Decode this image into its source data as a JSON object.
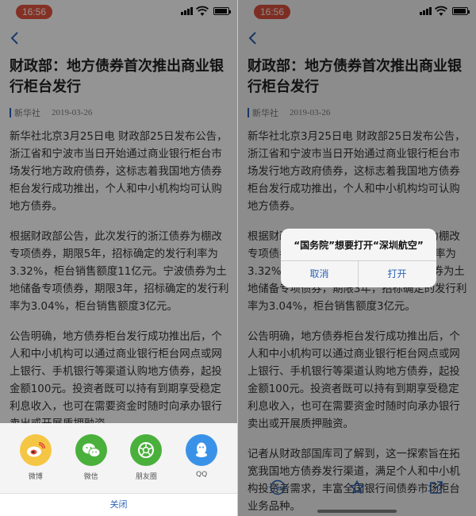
{
  "status": {
    "time": "16:56"
  },
  "article": {
    "title": "财政部：地方债券首次推出商业银行柜台发行",
    "source": "新华社",
    "date": "2019-03-26",
    "paragraphs": [
      "新华社北京3月25日电 财政部25日发布公告，浙江省和宁波市当日开始通过商业银行柜台市场发行地方政府债券，这标志着我国地方债券柜台发行成功推出，个人和中小机构均可认购地方债券。",
      "根据财政部公告，此次发行的浙江债券为棚改专项债券，期限5年，招标确定的发行利率为3.32%，柜台销售额度11亿元。宁波债券为土地储备专项债券，期限3年，招标确定的发行利率为3.04%，柜台销售额度3亿元。",
      "公告明确，地方债券柜台发行成功推出后，个人和中小机构可以通过商业银行柜台网点或网上银行、手机银行等渠道认购地方债券，起投金额100元。投资者既可以持有到期享受稳定利息收入，也可在需要资金时随时向承办银行卖出或开展质押融资。",
      "记者从财政部国库司了解到，这一探索旨在拓宽我国地方债券发行渠道，满足个人和中小机构投资者需求，丰富全国银行间债券市场柜台业务品种。"
    ]
  },
  "share_sheet": {
    "items": [
      {
        "label": "微博",
        "icon": "weibo-icon",
        "color": "#f5c644"
      },
      {
        "label": "微信",
        "icon": "wechat-icon",
        "color": "#4ab03c"
      },
      {
        "label": "朋友圈",
        "icon": "moments-icon",
        "color": "#4ab03c"
      },
      {
        "label": "QQ",
        "icon": "qq-icon",
        "color": "#3a92e8"
      }
    ],
    "close_label": "关闭"
  },
  "dialog": {
    "title": "“国务院”想要打开“深圳航空”",
    "cancel_label": "取消",
    "open_label": "打开"
  },
  "toolbar": {
    "icons": [
      "font-size-icon",
      "star-icon",
      "share-icon"
    ]
  }
}
